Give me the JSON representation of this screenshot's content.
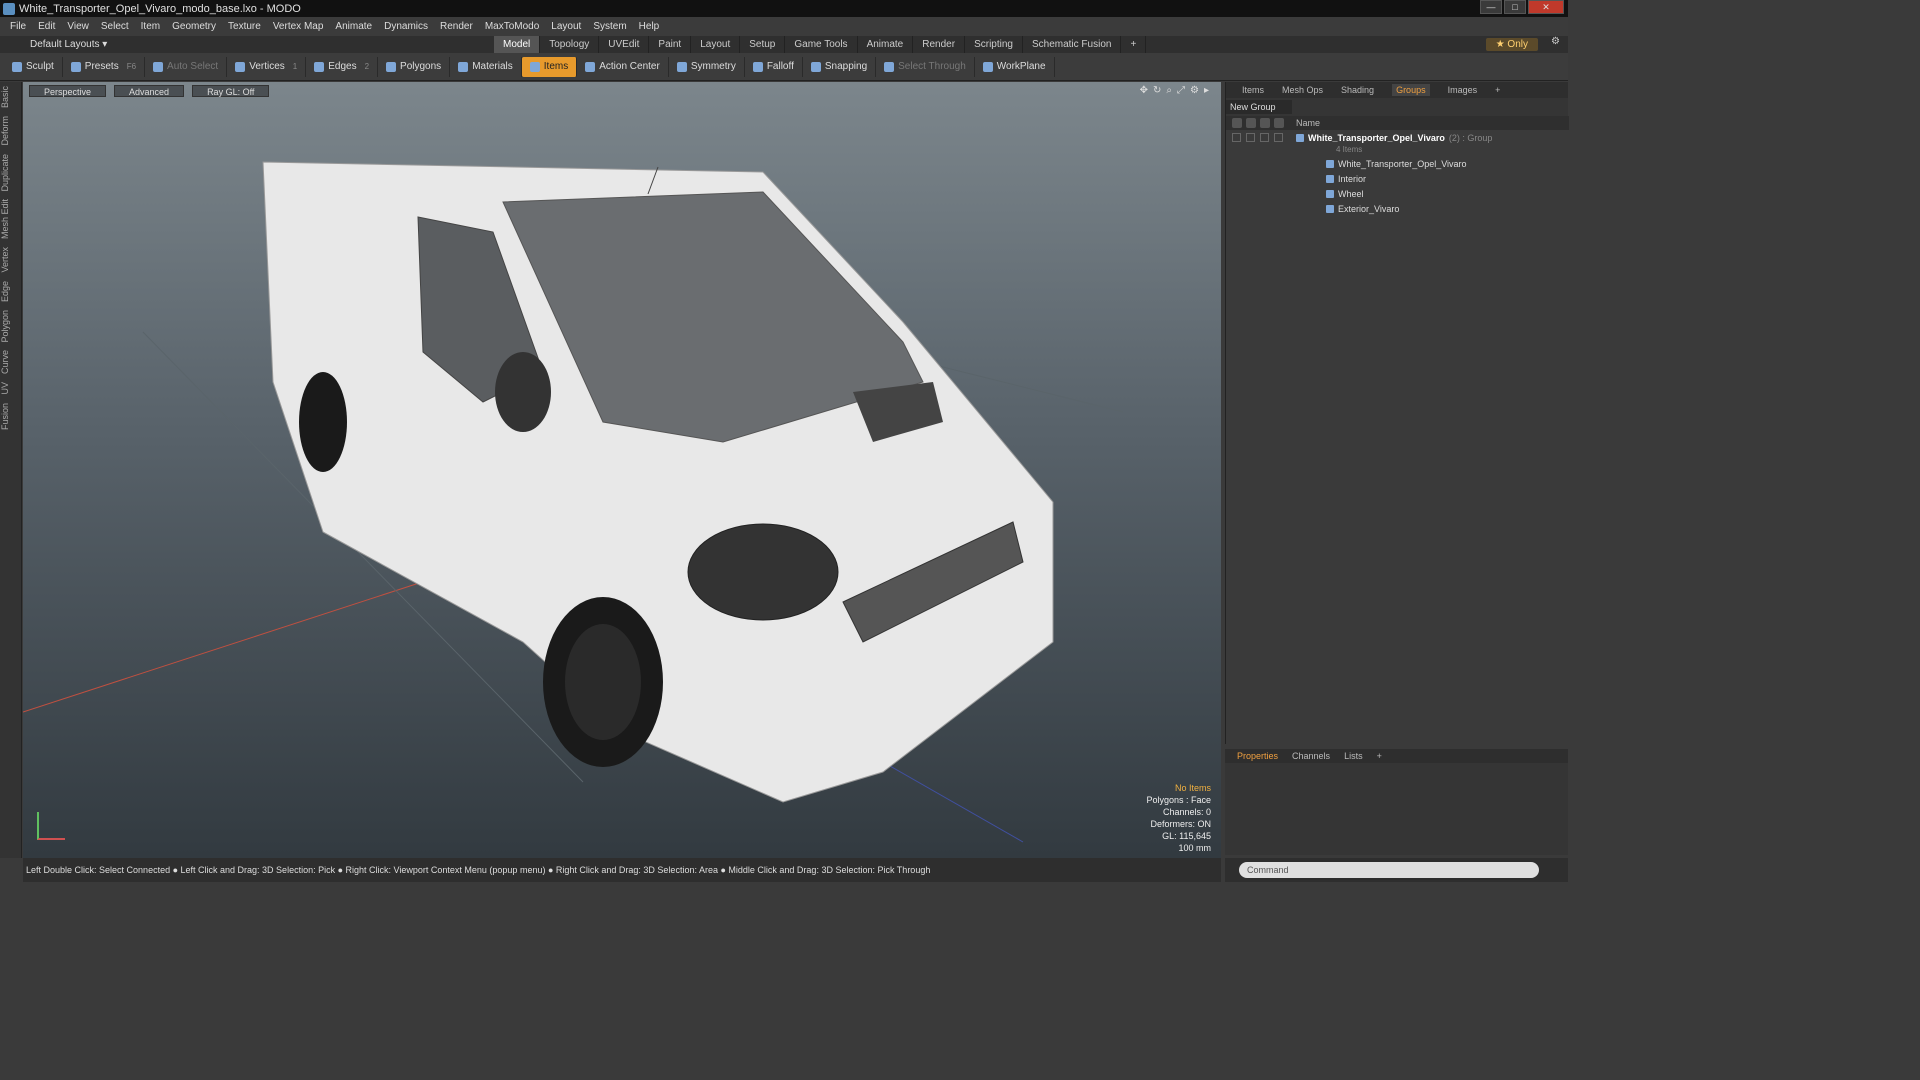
{
  "title": "White_Transporter_Opel_Vivaro_modo_base.lxo - MODO",
  "menu": [
    "File",
    "Edit",
    "View",
    "Select",
    "Item",
    "Geometry",
    "Texture",
    "Vertex Map",
    "Animate",
    "Dynamics",
    "Render",
    "MaxToModo",
    "Layout",
    "System",
    "Help"
  ],
  "layout_selector": "Default Layouts ▾",
  "mode_tabs": [
    "Model",
    "Topology",
    "UVEdit",
    "Paint",
    "Layout",
    "Setup",
    "Game Tools",
    "Animate",
    "Render",
    "Scripting",
    "Schematic Fusion"
  ],
  "mode_tab_plus": "+",
  "only_label": "★ Only",
  "toolbar": {
    "sculpt": "Sculpt",
    "presets": "Presets",
    "presets_key": "F6",
    "auto_select": "Auto Select",
    "vertices": "Vertices",
    "vertices_count": "1",
    "edges": "Edges",
    "edges_count": "2",
    "polygons": "Polygons",
    "materials": "Materials",
    "items": "Items",
    "action_center": "Action Center",
    "symmetry": "Symmetry",
    "falloff": "Falloff",
    "snapping": "Snapping",
    "select_through": "Select Through",
    "workplane": "WorkPlane"
  },
  "left_tabs": [
    "Basic",
    "Deform",
    "Duplicate",
    "Mesh Edit",
    "Vertex",
    "Edge",
    "Polygon",
    "Curve",
    "UV",
    "Fusion"
  ],
  "viewport": {
    "view": "Perspective",
    "shading": "Advanced",
    "raygl": "Ray GL: Off",
    "info": {
      "no_items": "No Items",
      "polygons": "Polygons : Face",
      "channels": "Channels: 0",
      "deformers": "Deformers: ON",
      "gl": "GL: 115,645",
      "scale": "100 mm"
    }
  },
  "status": "Left Double Click: Select Connected ● Left Click and Drag: 3D Selection: Pick ● Right Click: Viewport Context Menu (popup menu) ● Right Click and Drag: 3D Selection: Area ● Middle Click and Drag: 3D Selection: Pick Through",
  "right_tabs": [
    "Items",
    "Mesh Ops",
    "Shading",
    "Groups",
    "Images"
  ],
  "right_tab_plus": "+",
  "new_group": "New Group",
  "name_header": "Name",
  "group": {
    "name": "White_Transporter_Opel_Vivaro",
    "suffix": "(2) : Group",
    "count": "4 Items",
    "children": [
      "White_Transporter_Opel_Vivaro",
      "Interior",
      "Wheel",
      "Exterior_Vivaro"
    ]
  },
  "props_tabs": [
    "Properties",
    "Channels",
    "Lists"
  ],
  "props_tab_plus": "+",
  "command_placeholder": "Command"
}
